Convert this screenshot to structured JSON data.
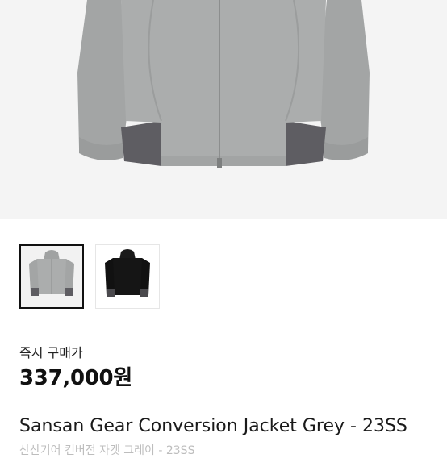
{
  "product": {
    "hero_image": "product-photo-grey-jacket",
    "thumbnails": [
      {
        "name": "grey-jacket-thumbnail",
        "selected": true
      },
      {
        "name": "black-jacket-thumbnail",
        "selected": false
      }
    ],
    "price_label": "즉시 구매가",
    "price": "337,000원",
    "title": "Sansan Gear Conversion Jacket Grey - 23SS",
    "subtitle": "산산기어 컨버전 자켓 그레이 - 23SS"
  },
  "colors": {
    "jacket_grey": "#a9abab",
    "panel_dark": "#5e5d62",
    "jacket_black": "#151515"
  }
}
